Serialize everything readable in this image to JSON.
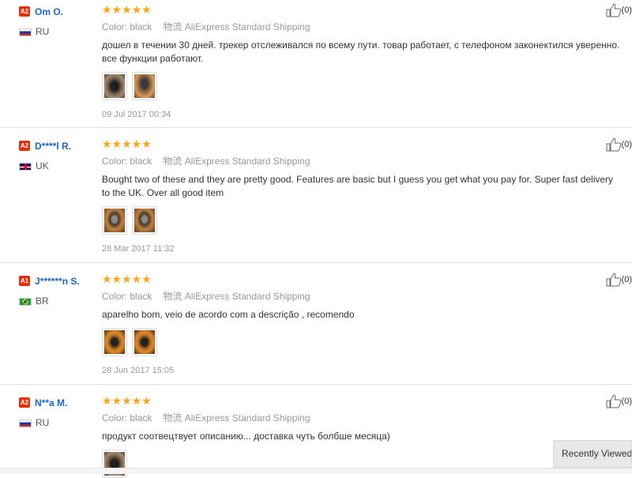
{
  "reviews": [
    {
      "badge": "A2",
      "name": "Om O.",
      "country": "RU",
      "stars": "★★★★★",
      "color_label": "Color:",
      "color_value": "black",
      "ship_label": "物流",
      "ship_value": "AliExpress Standard Shipping",
      "text": "дошел в течении 30 дней. трекер отслеживался по всему пути. товар работает, с телефоном законектился уверенно. все функции работают.",
      "date": "09 Jul 2017 00:34",
      "likes": "(0)"
    },
    {
      "badge": "A2",
      "name": "D****l R.",
      "country": "UK",
      "stars": "★★★★★",
      "color_label": "Color:",
      "color_value": "black",
      "ship_label": "物流",
      "ship_value": "AliExpress Standard Shipping",
      "text": "Bought two of these and they are pretty good. Features are basic but I guess you get what you pay for. Super fast delivery to the UK. Over all good item",
      "date": "28 Mar 2017 11:32",
      "likes": "(0)"
    },
    {
      "badge": "A1",
      "name": "J******n S.",
      "country": "BR",
      "stars": "★★★★★",
      "color_label": "Color:",
      "color_value": "black",
      "ship_label": "物流",
      "ship_value": "AliExpress Standard Shipping",
      "text": "aparelho bom, veio de acordo com a descrição , recomendo",
      "date": "28 Jun 2017 15:05",
      "likes": "(0)"
    },
    {
      "badge": "A2",
      "name": "N**a M.",
      "country": "RU",
      "stars": "★★★★★",
      "color_label": "Color:",
      "color_value": "black",
      "ship_label": "物流",
      "ship_value": "AliExpress Standard Shipping",
      "text": "продукт соотвецтвует описанию... доставка чуть болбше месяца)",
      "likes": "(0)"
    }
  ],
  "recently_viewed": "Recently Viewed",
  "colors": {
    "accent": "#e62e04",
    "star": "#ffa41c",
    "link": "#1f65b8"
  }
}
